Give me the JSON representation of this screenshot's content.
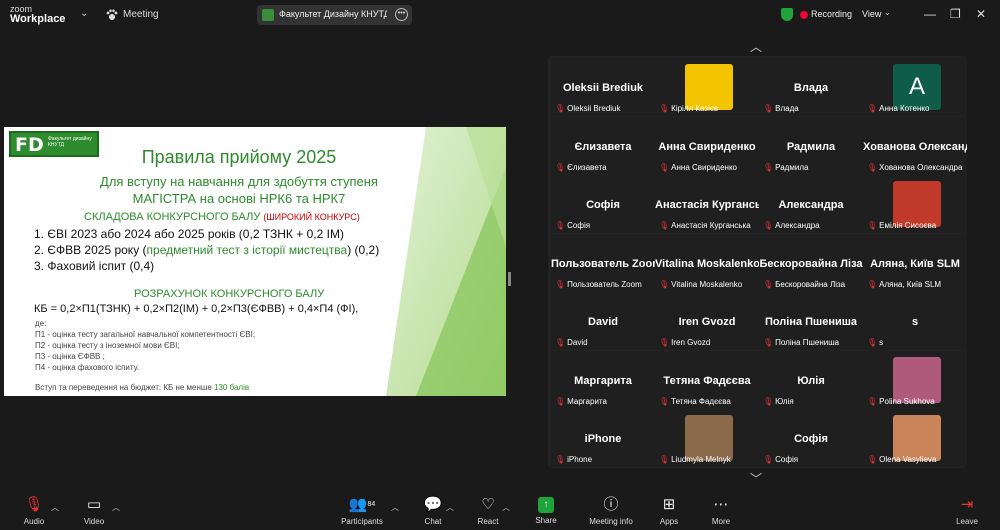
{
  "app": {
    "logo_line1": "zoom",
    "logo_line2": "Workplace",
    "meeting_label": "Meeting"
  },
  "share": {
    "title": "Факультет Дизайну КНУТД's scr"
  },
  "status": {
    "recording": "Recording",
    "view": "View"
  },
  "slide": {
    "logo_big": "FD",
    "logo_small": "Факультет дизайну КНУТД",
    "title": "Правила прийому 2025",
    "subtitle1": "Для вступу на навчання для здобуття ступеня",
    "subtitle2": "МАГІСТРА на основі НРК6 та НРК7",
    "section1": "СКЛАДОВА КОНКУРСНОГО БАЛУ",
    "section1_note": "(ШИРОКИЙ КОНКУРС)",
    "item1": "1.  ЄВІ 2023 або 2024 або 2025 років (0,2 ТЗНК + 0,2 ІМ)",
    "item2_a": "2.   ЄФВВ 2025 року (",
    "item2_b": "предметний тест з історії мистецтва",
    "item2_c": ") (0,2)",
    "item3": "3.  Фаховий іспит (0,4)",
    "section2": "РОЗРАХУНОК КОНКУРСНОГО БАЛУ",
    "formula": "КБ = 0,2×П1(ТЗНК) + 0,2×П2(ІМ) + 0,2×П3(ЄФВВ) + 0,4×П4 (ФІ),",
    "where": "де:",
    "p1": "П1 - оцінка тесту загальної навчальної компетентності ЄВІ;",
    "p2": "П2 - оцінка тесту з іноземної мови ЄВІ;",
    "p3": "П3 - оцінка ЄФВВ ;",
    "p4": "П4 - оцінка фахового іспиту.",
    "footer_a": "Вступ та переведення на бюджет: КБ не менше ",
    "footer_b": "130 балів"
  },
  "participants": [
    {
      "name": "Oleksii Brediuk",
      "caption": "Oleksii Brediuk"
    },
    {
      "name": "",
      "caption": "Кірілл Казієв"
    },
    {
      "name": "Влада",
      "caption": "Влада"
    },
    {
      "name": "",
      "caption": "Анна Котенко",
      "initial": "A"
    },
    {
      "name": "Єлизавета",
      "caption": "Єлизавета"
    },
    {
      "name": "Анна Свириденко",
      "caption": "Анна Свириденко"
    },
    {
      "name": "Радмила",
      "caption": "Радмила"
    },
    {
      "name": "Хованова Олександра",
      "caption": "Хованова Олександра"
    },
    {
      "name": "Софія",
      "caption": "Софія"
    },
    {
      "name": "Анастасія Курганська",
      "caption": "Анастасія Курганська"
    },
    {
      "name": "Александра",
      "caption": "Александра"
    },
    {
      "name": "",
      "caption": "Емілія Сисоєва"
    },
    {
      "name": "Пользователь Zoom",
      "caption": "Пользователь Zoom"
    },
    {
      "name": "Vitalina Moskalenko",
      "caption": "Vitalina Moskalenko"
    },
    {
      "name": "Бескоровайна Ліза",
      "caption": "Бескоровайна Ліза"
    },
    {
      "name": "Аляна, Київ SLM",
      "caption": "Аляна, Київ SLM"
    },
    {
      "name": "David",
      "caption": "David"
    },
    {
      "name": "Iren Gvozd",
      "caption": "Iren Gvozd"
    },
    {
      "name": "Поліна Пшениша",
      "caption": "Поліна Пшениша"
    },
    {
      "name": "s",
      "caption": "s"
    },
    {
      "name": "Маргарита",
      "caption": "Маргарита"
    },
    {
      "name": "Тетяна Фадєєва",
      "caption": "Тетяна Фадєєва"
    },
    {
      "name": "Юлія",
      "caption": "Юлія"
    },
    {
      "name": "",
      "caption": "Polina Sukhova"
    },
    {
      "name": "iPhone",
      "caption": "iPhone"
    },
    {
      "name": "",
      "caption": "Liudmyla Melnyk"
    },
    {
      "name": "Софія",
      "caption": "Софія"
    },
    {
      "name": "",
      "caption": "Olena Vasylieva"
    }
  ],
  "toolbar": {
    "audio": "Audio",
    "video": "Video",
    "participants": "Participants",
    "participants_count": "84",
    "chat": "Chat",
    "react": "React",
    "share": "Share",
    "meeting_info": "Meeting info",
    "apps": "Apps",
    "more": "More",
    "leave": "Leave"
  },
  "colors": {
    "accent_green": "#2e8b2e",
    "record_red": "#e03",
    "share_green": "#1fa33a"
  }
}
